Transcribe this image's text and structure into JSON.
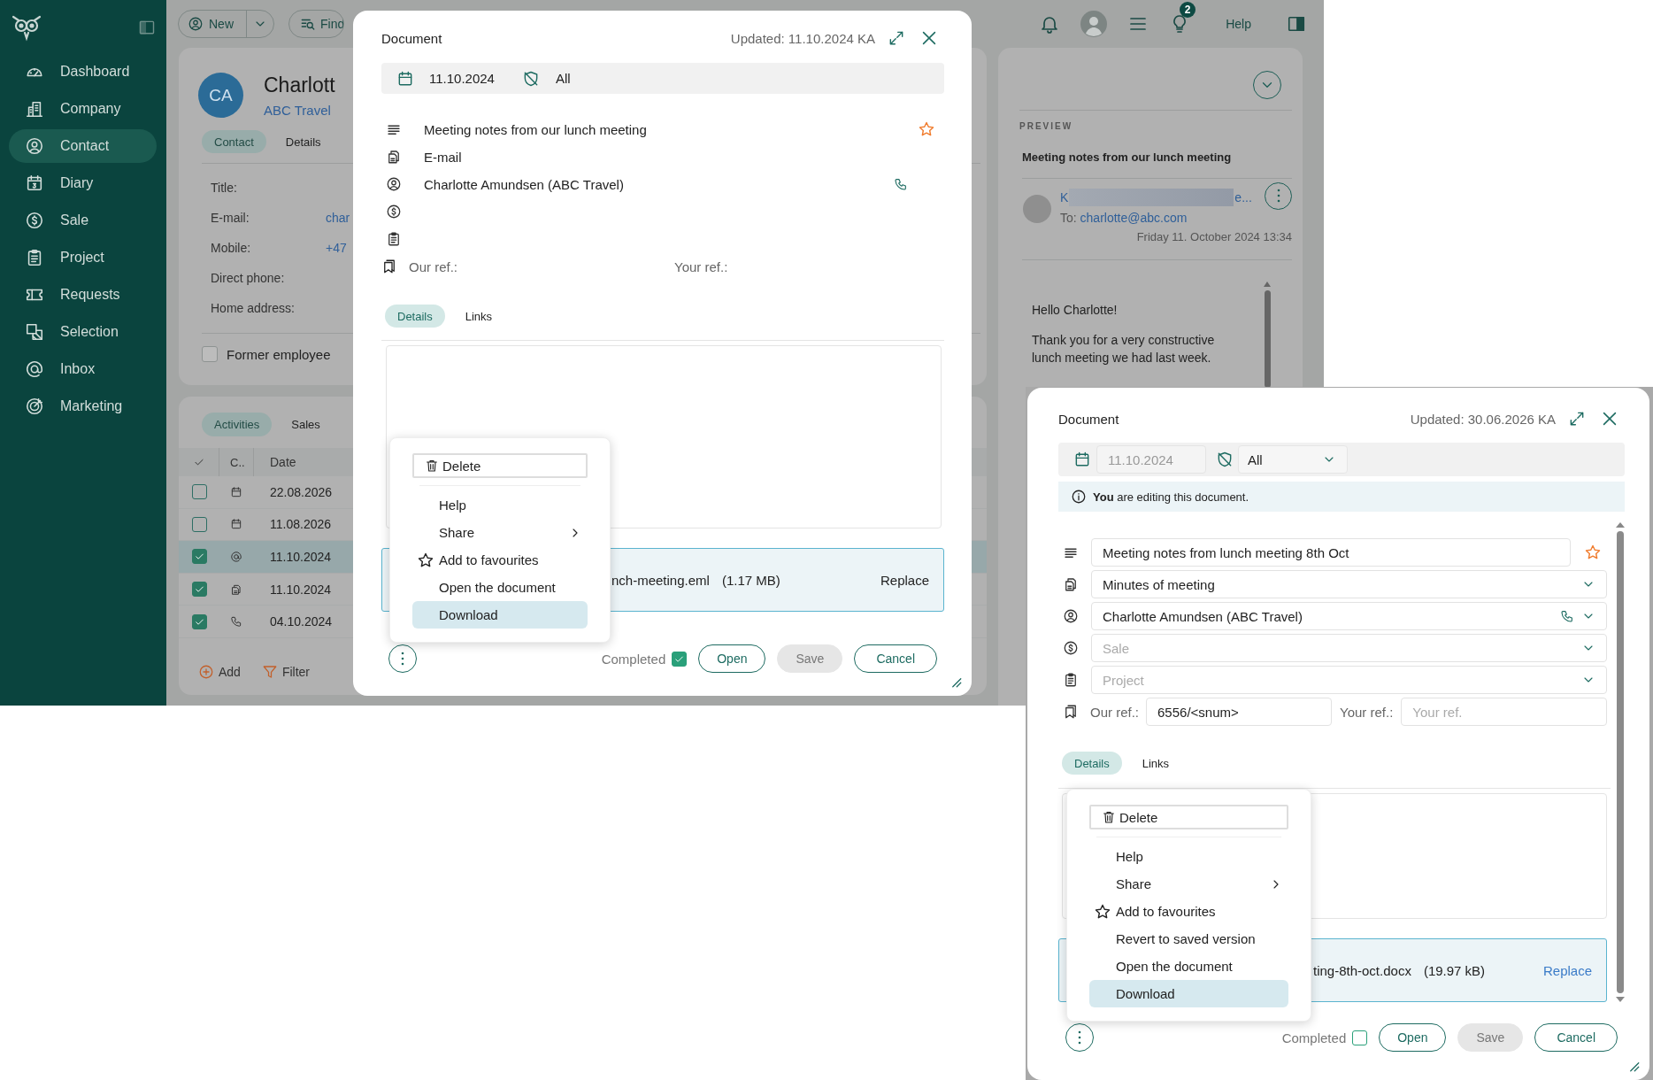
{
  "sidebar": {
    "items": [
      {
        "label": "Dashboard",
        "selected": false
      },
      {
        "label": "Company",
        "selected": false
      },
      {
        "label": "Contact",
        "selected": true
      },
      {
        "label": "Diary",
        "selected": false
      },
      {
        "label": "Sale",
        "selected": false
      },
      {
        "label": "Project",
        "selected": false
      },
      {
        "label": "Requests",
        "selected": false
      },
      {
        "label": "Selection",
        "selected": false
      },
      {
        "label": "Inbox",
        "selected": false
      },
      {
        "label": "Marketing",
        "selected": false
      }
    ]
  },
  "top_bar": {
    "new_button": "New",
    "find_button": "Find",
    "notification_count": "2",
    "help_link": "Help"
  },
  "contact": {
    "initials": "CA",
    "name": "Charlott",
    "company": "ABC Travel",
    "tabs": [
      {
        "label": "Contact",
        "selected": true
      },
      {
        "label": "Details",
        "selected": false
      }
    ],
    "fields": [
      {
        "label": "Title:"
      },
      {
        "label": "E-mail:",
        "value": "char"
      },
      {
        "label": "Mobile:",
        "value": "+47"
      },
      {
        "label": "Direct phone:"
      },
      {
        "label": "Home address:"
      }
    ],
    "former_employee": {
      "label": "Former employee",
      "checked": false
    }
  },
  "activities": {
    "tabs": [
      {
        "label": "Activities",
        "selected": true
      },
      {
        "label": "Sales",
        "selected": false
      }
    ],
    "columns": [
      "C..",
      "Date"
    ],
    "rows": [
      {
        "kind": "appointment",
        "date": "22.08.2026",
        "checked": false,
        "selected": false
      },
      {
        "kind": "appointment",
        "date": "11.08.2026",
        "checked": false,
        "selected": false
      },
      {
        "kind": "email",
        "date": "11.10.2024",
        "checked": true,
        "selected": true
      },
      {
        "kind": "document",
        "date": "11.10.2024",
        "checked": true,
        "selected": false
      },
      {
        "kind": "phone",
        "date": "04.10.2024",
        "checked": true,
        "selected": false
      }
    ],
    "actions": [
      "Add",
      "Filter"
    ]
  },
  "preview": {
    "heading": "PREVIEW",
    "title": "Meeting notes from our lunch meeting",
    "sender_start": "K",
    "sender_end": "e...",
    "to_label": "To:",
    "to_address": "charlotte@abc.com",
    "date": "Friday 11. October 2024 13:34",
    "body": [
      "Hello Charlotte!",
      "Thank you for a very constructive lunch meeting we had last week."
    ]
  },
  "dialogs": [
    {
      "editable": false,
      "title": "Document",
      "updated": "Updated: 11.10.2024 KA",
      "date": "11.10.2024",
      "visibility": "All",
      "fields": [
        {
          "kind": "title",
          "value": "Meeting notes from our lunch meeting"
        },
        {
          "kind": "type",
          "value": "E-mail"
        },
        {
          "kind": "contact",
          "value": "Charlotte Amundsen (ABC Travel)"
        },
        {
          "kind": "sale"
        },
        {
          "kind": "project"
        }
      ],
      "refs": {
        "our_label": "Our ref.:",
        "your_label": "Your ref.:"
      },
      "tabs": [
        {
          "label": "Details",
          "selected": true
        },
        {
          "label": "Links",
          "selected": false
        }
      ],
      "attachment": {
        "filename": "nch-meeting.eml",
        "size": "(1.17 MB)",
        "action": "Replace"
      },
      "menu": [
        {
          "kind": "delete",
          "label": "Delete",
          "selected": false
        },
        {
          "kind": "plain",
          "label": "Help",
          "selected": false
        },
        {
          "kind": "submenu",
          "label": "Share",
          "selected": false
        },
        {
          "kind": "favourite",
          "label": "Add to favourites",
          "selected": false
        },
        {
          "kind": "plain",
          "label": "Open the document",
          "selected": false
        },
        {
          "kind": "plain",
          "label": "Download",
          "selected": true
        }
      ],
      "completed": {
        "label": "Completed",
        "checked": true
      },
      "buttons": [
        {
          "label": "Open",
          "disabled": false
        },
        {
          "label": "Save",
          "disabled": true
        },
        {
          "label": "Cancel",
          "disabled": false
        }
      ]
    },
    {
      "editable": true,
      "title": "Document",
      "updated": "Updated: 30.06.2026 KA",
      "date": "11.10.2024",
      "visibility": "All",
      "notice": "**You** are editing this document.",
      "fields": [
        {
          "kind": "title",
          "value": "Meeting notes from lunch meeting 8th Oct"
        },
        {
          "kind": "type",
          "value": "Minutes of meeting"
        },
        {
          "kind": "contact",
          "value": "Charlotte Amundsen (ABC Travel)"
        },
        {
          "kind": "sale",
          "placeholder": "Sale"
        },
        {
          "kind": "project",
          "placeholder": "Project"
        }
      ],
      "refs": {
        "our_label": "Our ref.:",
        "our_value": "6556/<snum>",
        "your_label": "Your ref.:",
        "your_placeholder": "Your ref."
      },
      "tabs": [
        {
          "label": "Details",
          "selected": true
        },
        {
          "label": "Links",
          "selected": false
        }
      ],
      "attachment": {
        "filename": "ting-8th-oct.docx",
        "size": "(19.97 kB)",
        "action": "Replace"
      },
      "menu": [
        {
          "kind": "delete",
          "label": "Delete",
          "selected": false
        },
        {
          "kind": "plain",
          "label": "Help",
          "selected": false
        },
        {
          "kind": "submenu",
          "label": "Share",
          "selected": false
        },
        {
          "kind": "favourite",
          "label": "Add to favourites",
          "selected": false
        },
        {
          "kind": "plain",
          "label": "Revert to saved version",
          "selected": false
        },
        {
          "kind": "plain",
          "label": "Open the document",
          "selected": false
        },
        {
          "kind": "plain",
          "label": "Download",
          "selected": true
        }
      ],
      "completed": {
        "label": "Completed",
        "checked": false
      },
      "buttons": [
        {
          "label": "Open",
          "disabled": false
        },
        {
          "label": "Save",
          "disabled": true
        },
        {
          "label": "Cancel",
          "disabled": false
        }
      ]
    }
  ]
}
